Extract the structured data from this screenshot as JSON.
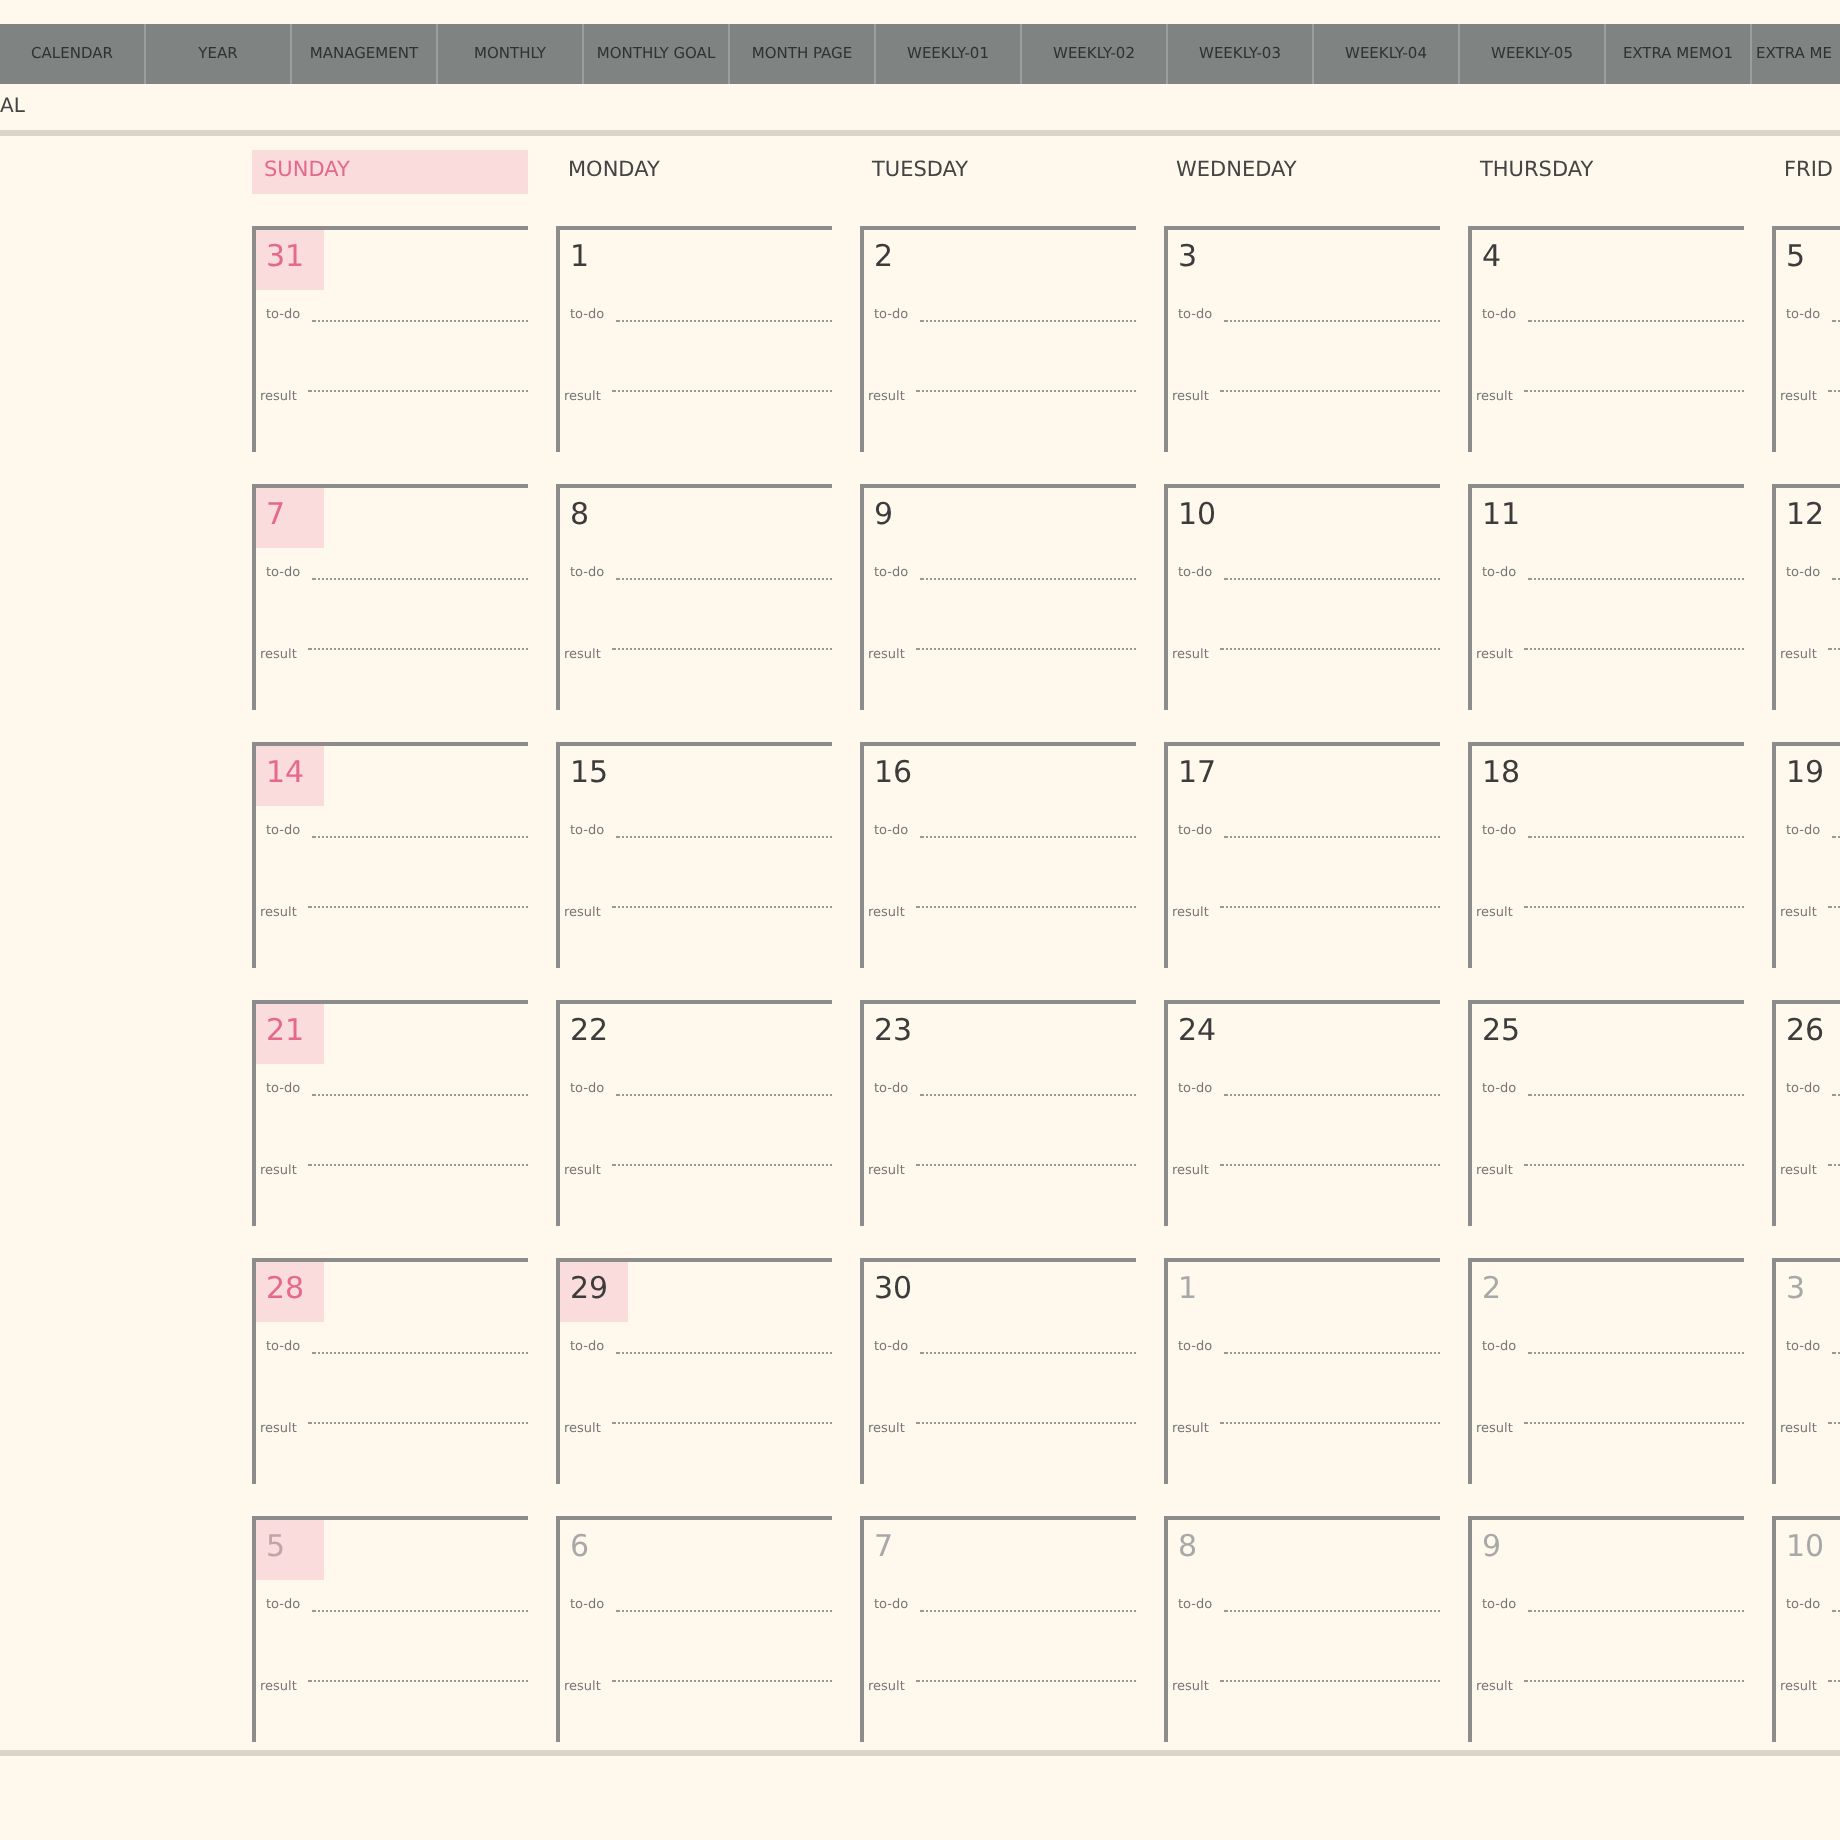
{
  "tabs": [
    {
      "label": "CALENDAR"
    },
    {
      "label": "YEAR"
    },
    {
      "label": "MANAGEMENT"
    },
    {
      "label": "MONTHLY"
    },
    {
      "label": "MONTHLY GOAL"
    },
    {
      "label": "MONTH PAGE"
    },
    {
      "label": "WEEKLY-01"
    },
    {
      "label": "WEEKLY-02"
    },
    {
      "label": "WEEKLY-03"
    },
    {
      "label": "WEEKLY-04"
    },
    {
      "label": "WEEKLY-05"
    },
    {
      "label": "EXTRA MEMO1"
    },
    {
      "label": "EXTRA ME"
    }
  ],
  "page_title": "AL",
  "weekdays": [
    {
      "label": "SUNDAY",
      "highlighted": true
    },
    {
      "label": "MONDAY",
      "highlighted": false
    },
    {
      "label": "TUESDAY",
      "highlighted": false
    },
    {
      "label": "WEDNEDAY",
      "highlighted": false
    },
    {
      "label": "THURSDAY",
      "highlighted": false
    },
    {
      "label": "FRID",
      "highlighted": false
    }
  ],
  "weeks": [
    {
      "days": [
        {
          "date": "31",
          "holiday": true,
          "highlighted": true,
          "muted": false,
          "todo_label": "to-do",
          "result_label": "result"
        },
        {
          "date": "1",
          "holiday": false,
          "highlighted": false,
          "muted": false,
          "todo_label": "to-do",
          "result_label": "result"
        },
        {
          "date": "2",
          "holiday": false,
          "highlighted": false,
          "muted": false,
          "todo_label": "to-do",
          "result_label": "result"
        },
        {
          "date": "3",
          "holiday": false,
          "highlighted": false,
          "muted": false,
          "todo_label": "to-do",
          "result_label": "result"
        },
        {
          "date": "4",
          "holiday": false,
          "highlighted": false,
          "muted": false,
          "todo_label": "to-do",
          "result_label": "result"
        },
        {
          "date": "5",
          "holiday": false,
          "highlighted": false,
          "muted": false,
          "todo_label": "to-do",
          "result_label": "result"
        }
      ]
    },
    {
      "days": [
        {
          "date": "7",
          "holiday": true,
          "highlighted": true,
          "muted": false,
          "todo_label": "to-do",
          "result_label": "result"
        },
        {
          "date": "8",
          "holiday": false,
          "highlighted": false,
          "muted": false,
          "todo_label": "to-do",
          "result_label": "result"
        },
        {
          "date": "9",
          "holiday": false,
          "highlighted": false,
          "muted": false,
          "todo_label": "to-do",
          "result_label": "result"
        },
        {
          "date": "10",
          "holiday": false,
          "highlighted": false,
          "muted": false,
          "todo_label": "to-do",
          "result_label": "result"
        },
        {
          "date": "11",
          "holiday": false,
          "highlighted": false,
          "muted": false,
          "todo_label": "to-do",
          "result_label": "result"
        },
        {
          "date": "12",
          "holiday": false,
          "highlighted": false,
          "muted": false,
          "todo_label": "to-do",
          "result_label": "result"
        }
      ]
    },
    {
      "days": [
        {
          "date": "14",
          "holiday": true,
          "highlighted": true,
          "muted": false,
          "todo_label": "to-do",
          "result_label": "result"
        },
        {
          "date": "15",
          "holiday": false,
          "highlighted": false,
          "muted": false,
          "todo_label": "to-do",
          "result_label": "result"
        },
        {
          "date": "16",
          "holiday": false,
          "highlighted": false,
          "muted": false,
          "todo_label": "to-do",
          "result_label": "result"
        },
        {
          "date": "17",
          "holiday": false,
          "highlighted": false,
          "muted": false,
          "todo_label": "to-do",
          "result_label": "result"
        },
        {
          "date": "18",
          "holiday": false,
          "highlighted": false,
          "muted": false,
          "todo_label": "to-do",
          "result_label": "result"
        },
        {
          "date": "19",
          "holiday": false,
          "highlighted": false,
          "muted": false,
          "todo_label": "to-do",
          "result_label": "result"
        }
      ]
    },
    {
      "days": [
        {
          "date": "21",
          "holiday": true,
          "highlighted": true,
          "muted": false,
          "todo_label": "to-do",
          "result_label": "result"
        },
        {
          "date": "22",
          "holiday": false,
          "highlighted": false,
          "muted": false,
          "todo_label": "to-do",
          "result_label": "result"
        },
        {
          "date": "23",
          "holiday": false,
          "highlighted": false,
          "muted": false,
          "todo_label": "to-do",
          "result_label": "result"
        },
        {
          "date": "24",
          "holiday": false,
          "highlighted": false,
          "muted": false,
          "todo_label": "to-do",
          "result_label": "result"
        },
        {
          "date": "25",
          "holiday": false,
          "highlighted": false,
          "muted": false,
          "todo_label": "to-do",
          "result_label": "result"
        },
        {
          "date": "26",
          "holiday": false,
          "highlighted": false,
          "muted": false,
          "todo_label": "to-do",
          "result_label": "result"
        }
      ]
    },
    {
      "days": [
        {
          "date": "28",
          "holiday": true,
          "highlighted": true,
          "muted": false,
          "todo_label": "to-do",
          "result_label": "result"
        },
        {
          "date": "29",
          "holiday": false,
          "highlighted": true,
          "muted": false,
          "todo_label": "to-do",
          "result_label": "result"
        },
        {
          "date": "30",
          "holiday": false,
          "highlighted": false,
          "muted": false,
          "todo_label": "to-do",
          "result_label": "result"
        },
        {
          "date": "1",
          "holiday": false,
          "highlighted": false,
          "muted": true,
          "todo_label": "to-do",
          "result_label": "result"
        },
        {
          "date": "2",
          "holiday": false,
          "highlighted": false,
          "muted": true,
          "todo_label": "to-do",
          "result_label": "result"
        },
        {
          "date": "3",
          "holiday": false,
          "highlighted": false,
          "muted": true,
          "todo_label": "to-do",
          "result_label": "result"
        }
      ]
    },
    {
      "days": [
        {
          "date": "5",
          "holiday": true,
          "highlighted": true,
          "muted": true,
          "todo_label": "to-do",
          "result_label": "result"
        },
        {
          "date": "6",
          "holiday": false,
          "highlighted": false,
          "muted": true,
          "todo_label": "to-do",
          "result_label": "result"
        },
        {
          "date": "7",
          "holiday": false,
          "highlighted": false,
          "muted": true,
          "todo_label": "to-do",
          "result_label": "result"
        },
        {
          "date": "8",
          "holiday": false,
          "highlighted": false,
          "muted": true,
          "todo_label": "to-do",
          "result_label": "result"
        },
        {
          "date": "9",
          "holiday": false,
          "highlighted": false,
          "muted": true,
          "todo_label": "to-do",
          "result_label": "result"
        },
        {
          "date": "10",
          "holiday": false,
          "highlighted": false,
          "muted": true,
          "todo_label": "to-do",
          "result_label": "result"
        }
      ]
    }
  ]
}
